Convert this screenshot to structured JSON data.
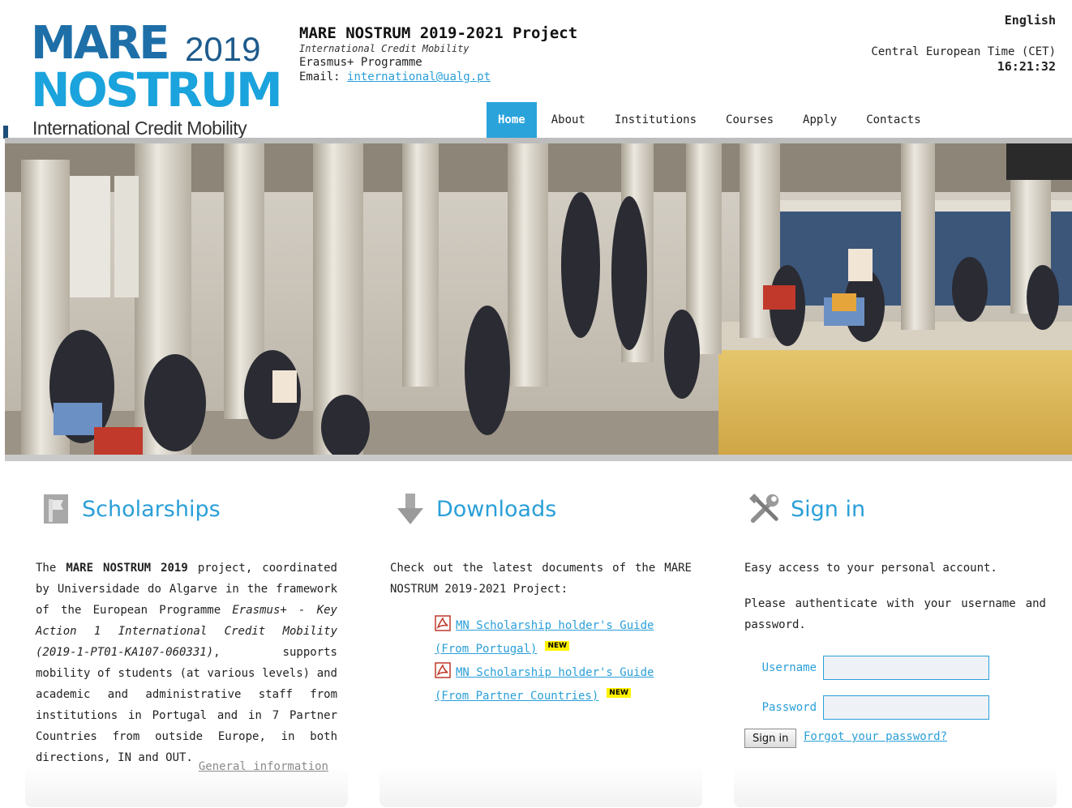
{
  "header": {
    "logo": {
      "mare": "MARE",
      "year": "2019",
      "nostrum": "NOSTRUM",
      "tagline": "International Credit Mobility"
    },
    "project": {
      "title": "MARE NOSTRUM 2019-2021 Project",
      "subtitle": "International Credit Mobility",
      "programme": "Erasmus+ Programme",
      "email_label": "Email:",
      "email": "international@ualg.pt"
    },
    "language": "English",
    "clock": {
      "timezone": "Central European Time (CET)",
      "time": "16:21:32"
    }
  },
  "nav": {
    "items": [
      {
        "label": "Home",
        "active": true
      },
      {
        "label": "About",
        "active": false
      },
      {
        "label": "Institutions",
        "active": false
      },
      {
        "label": "Courses",
        "active": false
      },
      {
        "label": "Apply",
        "active": false
      },
      {
        "label": "Contacts",
        "active": false
      }
    ]
  },
  "hero": {
    "icon": "cloister-students-photo"
  },
  "scholarships": {
    "title": "Scholarships",
    "icon": "flag-icon",
    "text": {
      "t1": "The ",
      "b1": "MARE NOSTRUM 2019",
      "t2": " project, coordinated by Universidade do Algarve in the framework of the European Programme ",
      "i1": "Erasmus+ - Key Action 1 International Credit Mobility (2019-1-PT01-KA107-060331)",
      "t3": ", supports mobility of students (at various levels) and academic and administrative staff from institutions in Portugal and in 7 Partner Countries from outside Europe, in both directions, IN and OUT."
    },
    "general_link": "General information"
  },
  "downloads": {
    "title": "Downloads",
    "icon": "download-arrow-icon",
    "intro": "Check out the latest documents of the MARE NOSTRUM 2019-2021 Project:",
    "items": [
      {
        "label": "MN Scholarship holder's Guide (From Portugal)",
        "badge": "NEW",
        "icon": "pdf-icon"
      },
      {
        "label": "MN Scholarship holder's Guide (From Partner Countries)",
        "badge": "NEW",
        "icon": "pdf-icon"
      }
    ]
  },
  "signin": {
    "title": "Sign in",
    "icon": "tools-icon",
    "intro": "Easy access to your personal account.",
    "instruction": "Please authenticate with your username and password.",
    "username_label": "Username",
    "username_value": "",
    "password_label": "Password",
    "password_value": "",
    "button": "Sign in",
    "forgot": "Forgot your password?"
  },
  "colors": {
    "accent": "#2aa3db",
    "link": "#2a9fd8",
    "logo_dark": "#1e6fa8",
    "logo_light": "#1aa3dc",
    "badge": "#fff200"
  }
}
